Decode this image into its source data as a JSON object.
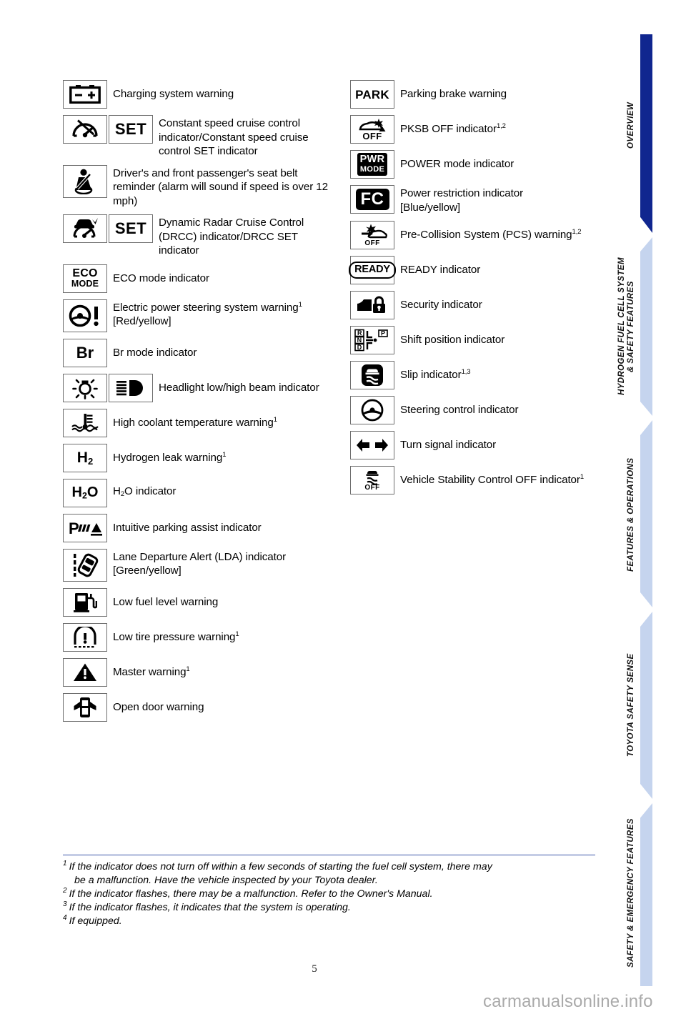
{
  "page": {
    "number": "5",
    "watermark": "carmanualsonline.info"
  },
  "side_tabs": [
    {
      "label": "OVERVIEW",
      "active": true
    },
    {
      "label": "HYDROGEN FUEL CELL SYSTEM\n& SAFETY FEATURES",
      "active": false
    },
    {
      "label": "FEATURES & OPERATIONS",
      "active": false
    },
    {
      "label": "TOYOTA SAFETY SENSE",
      "active": false
    },
    {
      "label": "SAFETY & EMERGENCY FEATURES",
      "active": false
    }
  ],
  "colors": {
    "tab_active": "#10268f",
    "tab_inactive": "#c5d4ee",
    "footnote_rule": "#3a55a8",
    "icon_border": "#6e6e6e",
    "watermark": "#aaaaaa"
  },
  "left_column": [
    {
      "icons": [
        "battery-icon"
      ],
      "desc": "Charging system warning"
    },
    {
      "icons": [
        "cruise-control-icon",
        "set-text-icon"
      ],
      "desc": "Constant speed cruise control indicator/Constant speed cruise control SET indicator"
    },
    {
      "icons": [
        "seat-belt-reminder-icon"
      ],
      "desc": "Driver's and front passenger's seat belt reminder (alarm will sound if speed is over 12 mph)"
    },
    {
      "icons": [
        "drcc-icon",
        "set-text-icon"
      ],
      "desc": "Dynamic Radar Cruise Control (DRCC) indicator/DRCC SET indicator"
    },
    {
      "icons": [
        "eco-mode-icon"
      ],
      "desc": "ECO mode indicator"
    },
    {
      "icons": [
        "electric-power-steering-icon"
      ],
      "desc": "Electric power steering system warning",
      "footnote": "1",
      "desc2": "[Red/yellow]"
    },
    {
      "icons": [
        "br-mode-icon"
      ],
      "desc": "Br mode indicator"
    },
    {
      "icons": [
        "headlight-low-beam-icon",
        "headlight-high-beam-icon"
      ],
      "desc": "Headlight low/high beam indicator"
    },
    {
      "icons": [
        "coolant-temperature-icon"
      ],
      "desc": "High coolant temperature warning",
      "footnote": "1"
    },
    {
      "icons": [
        "hydrogen-leak-icon"
      ],
      "desc": "Hydrogen leak warning",
      "footnote": "1"
    },
    {
      "icons": [
        "h2o-icon"
      ],
      "desc_html": "H2O indicator"
    },
    {
      "icons": [
        "intuitive-parking-assist-icon"
      ],
      "desc": "Intuitive parking assist indicator"
    },
    {
      "icons": [
        "lane-departure-alert-icon"
      ],
      "desc": "Lane Departure Alert (LDA) indicator",
      "desc2": "[Green/yellow]"
    },
    {
      "icons": [
        "low-fuel-icon"
      ],
      "desc": "Low fuel level warning"
    },
    {
      "icons": [
        "low-tire-pressure-icon"
      ],
      "desc": "Low tire pressure warning",
      "footnote": "1"
    },
    {
      "icons": [
        "master-warning-icon"
      ],
      "desc": "Master warning",
      "footnote": "1"
    },
    {
      "icons": [
        "open-door-icon"
      ],
      "desc": "Open door warning"
    }
  ],
  "right_column": [
    {
      "icons": [
        "park-text-icon"
      ],
      "desc": "Parking brake warning"
    },
    {
      "icons": [
        "pksb-off-icon"
      ],
      "desc": "PKSB OFF indicator",
      "footnote": "1,2"
    },
    {
      "icons": [
        "power-mode-icon"
      ],
      "desc": "POWER mode indicator"
    },
    {
      "icons": [
        "power-restriction-icon"
      ],
      "desc": "Power restriction indicator",
      "desc2": "[Blue/yellow]"
    },
    {
      "icons": [
        "pre-collision-system-icon"
      ],
      "desc": "Pre-Collision System (PCS) warning",
      "footnote": "1,2"
    },
    {
      "icons": [
        "ready-icon"
      ],
      "desc": "READY indicator"
    },
    {
      "icons": [
        "security-icon"
      ],
      "desc": "Security indicator"
    },
    {
      "icons": [
        "shift-position-icon"
      ],
      "desc": "Shift position indicator"
    },
    {
      "icons": [
        "slip-indicator-icon"
      ],
      "desc": "Slip indicator",
      "footnote": "1,3"
    },
    {
      "icons": [
        "steering-control-icon"
      ],
      "desc": "Steering control indicator"
    },
    {
      "icons": [
        "turn-signal-icon"
      ],
      "desc": "Turn signal indicator"
    },
    {
      "icons": [
        "vsc-off-icon"
      ],
      "desc": "Vehicle Stability Control OFF indicator",
      "footnote": "1"
    }
  ],
  "icon_labels": {
    "set": "SET",
    "park": "PARK",
    "br": "Br",
    "eco_line1": "ECO",
    "eco_line2": "MODE",
    "pwr_line1": "PWR",
    "pwr_line2": "MODE",
    "fc": "FC",
    "ready": "READY",
    "off": "OFF",
    "shift_r": "R",
    "shift_n": "N",
    "shift_d": "D",
    "shift_p": "P"
  },
  "footnotes": [
    {
      "marker": "1",
      "line1": "If the indicator does not turn off within a few seconds of starting the fuel cell system, there may",
      "line2": "be a malfunction. Have the vehicle inspected by your Toyota dealer."
    },
    {
      "marker": "2",
      "line1": "If the indicator flashes, there may be a malfunction. Refer to the Owner's Manual."
    },
    {
      "marker": "3",
      "line1": "If the indicator flashes, it indicates that the system is operating."
    },
    {
      "marker": "4",
      "line1": "If equipped."
    }
  ]
}
